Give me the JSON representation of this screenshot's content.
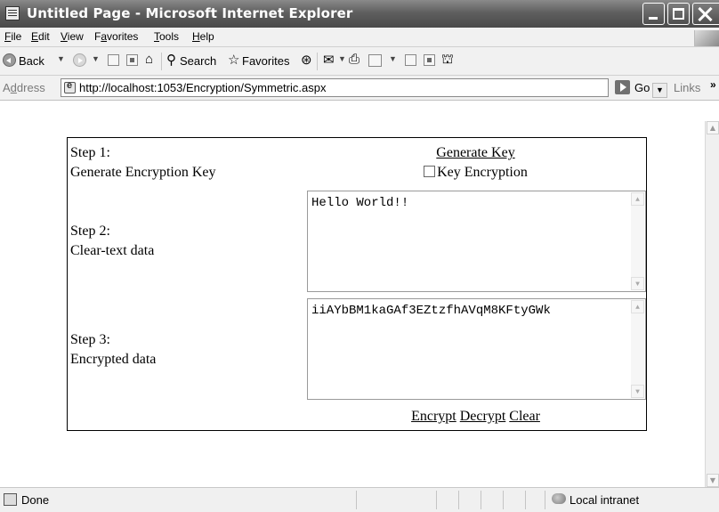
{
  "window": {
    "title": "Untitled Page - Microsoft Internet Explorer"
  },
  "menu": {
    "items": [
      {
        "key": "F",
        "rest": "ile"
      },
      {
        "key": "E",
        "rest": "dit"
      },
      {
        "key": "V",
        "rest": "iew"
      },
      {
        "pre": "F",
        "key": "a",
        "rest": "vorites"
      },
      {
        "key": "T",
        "rest": "ools"
      },
      {
        "key": "H",
        "rest": "elp"
      }
    ]
  },
  "toolbar": {
    "back_label": "Back",
    "search_label": "Search",
    "favorites_label": "Favorites"
  },
  "address": {
    "label_pre": "A",
    "label_key": "d",
    "label_rest": "dress",
    "url": "http://localhost:1053/Encryption/Symmetric.aspx",
    "go_label": "Go",
    "links_label": "Links",
    "more": "»"
  },
  "page": {
    "step1_title": "Step 1:",
    "step1_desc": "Generate Encryption Key",
    "generate_key": "Generate Key",
    "key_encryption": "Key Encryption",
    "key_encryption_checked": false,
    "step2_title": "Step 2:",
    "step2_desc": "Clear-text data",
    "clear_text": "Hello World!!",
    "step3_title": "Step 3:",
    "step3_desc": "Encrypted data",
    "encrypted_text": "iiAYbBM1kaGAf3EZtzfhAVqM8KFtyGWk",
    "encrypt": "Encrypt",
    "decrypt": "Decrypt",
    "clear": "Clear"
  },
  "status": {
    "text": "Done",
    "zone": "Local intranet"
  },
  "colors": {
    "titlebar": "#5f5f5f",
    "chrome": "#f1f1f1",
    "border": "#000000"
  }
}
